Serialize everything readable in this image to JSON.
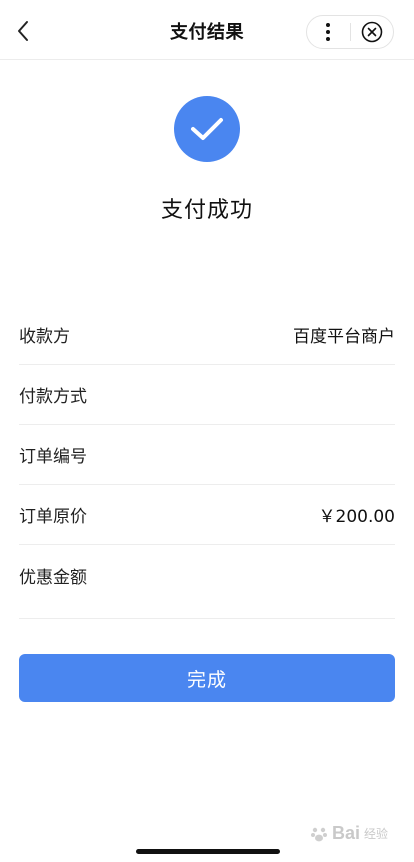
{
  "header": {
    "title": "支付结果"
  },
  "result": {
    "status_text": "支付成功"
  },
  "info": [
    {
      "label": "收款方",
      "value": "百度平台商户"
    },
    {
      "label": "付款方式",
      "value": ""
    },
    {
      "label": "订单编号",
      "value": ""
    },
    {
      "label": "订单原价",
      "value": "￥200.00"
    },
    {
      "label": "优惠金额",
      "value": ""
    }
  ],
  "actions": {
    "done_label": "完成"
  },
  "watermark": {
    "brand": "Bai",
    "sub": "经验"
  },
  "colors": {
    "accent": "#4a86f0",
    "divider": "#ededed"
  },
  "icons": {
    "back": "chevron-left-icon",
    "more": "more-vertical-icon",
    "close": "close-circle-icon",
    "success": "check-icon"
  }
}
